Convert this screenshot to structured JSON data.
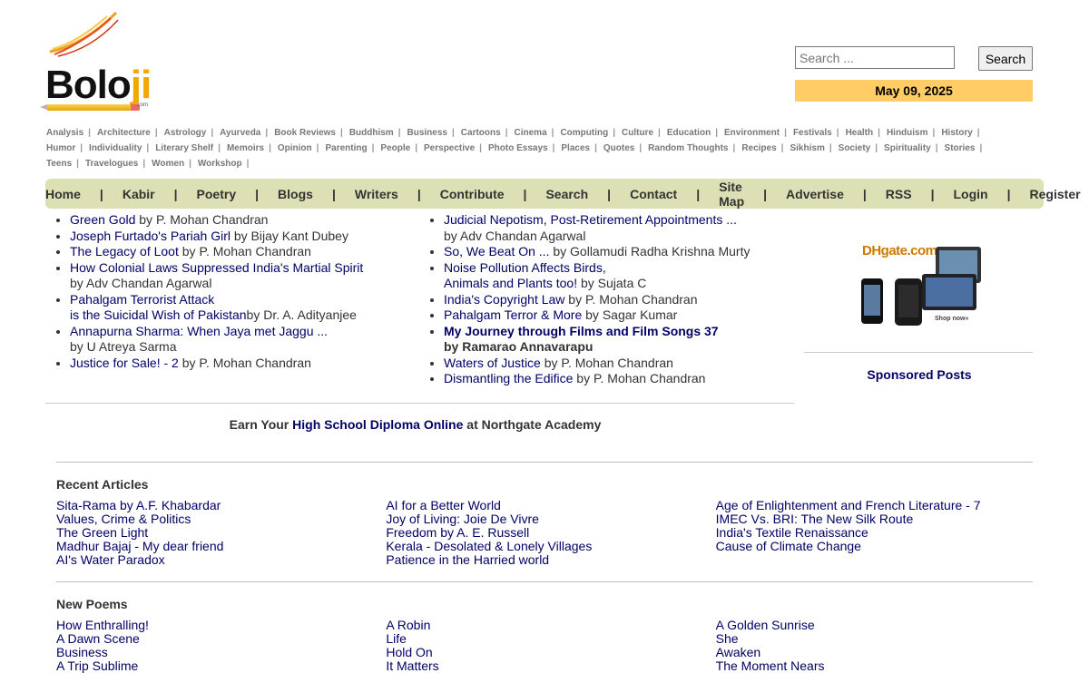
{
  "logo": {
    "text_main": "Bolo",
    "text_accent": "ji",
    "domain_suffix": ".com"
  },
  "search": {
    "placeholder": "Search ...",
    "button_label": "Search"
  },
  "date": "May 09, 2025",
  "categories": [
    "Analysis",
    "Architecture",
    "Astrology",
    "Ayurveda",
    "Book Reviews",
    "Buddhism",
    "Business",
    "Cartoons",
    "Cinema",
    "Computing",
    "Culture",
    "Education",
    "Environment",
    "Festivals",
    "Health",
    "Hinduism",
    "History",
    "Humor",
    "Individuality",
    "Literary Shelf",
    "Memoirs",
    "Opinion",
    "Parenting",
    "People",
    "Perspective",
    "Photo Essays",
    "Places",
    "Quotes",
    "Random Thoughts",
    "Recipes",
    "Sikhism",
    "Society",
    "Spirituality",
    "Stories",
    "Teens",
    "Travelogues",
    "Women",
    "Workshop"
  ],
  "nav": [
    "Home",
    "Kabir",
    "Poetry",
    "Blogs",
    "Writers",
    "Contribute",
    "Search",
    "Contact",
    "Site Map",
    "Advertise",
    "RSS",
    "Login",
    "Register"
  ],
  "featured_left": [
    {
      "title": "Green Gold",
      "by": " by P. Mohan Chandran"
    },
    {
      "title": "Joseph Furtado's Pariah Girl",
      "by": " by Bijay Kant Dubey"
    },
    {
      "title": "The Legacy of Loot",
      "by": " by P. Mohan Chandran"
    },
    {
      "title": "How Colonial Laws Suppressed India's Martial Spirit",
      "by": "by Adv Chandan Agarwal"
    },
    {
      "title": "Pahalgam Terrorist Attack",
      "title2": "is the Suicidal Wish of Pakistan",
      "by": "by Dr. A. Adityanjee"
    },
    {
      "title": "Annapurna Sharma: When Jaya met Jaggu ...",
      "by": "by U Atreya Sarma"
    },
    {
      "title": "Justice for Sale! - 2",
      "by": " by P. Mohan Chandran"
    }
  ],
  "featured_right": [
    {
      "title": "Judicial Nepotism, Post-Retirement Appointments ...",
      "by": "by Adv Chandan Agarwal"
    },
    {
      "title": "So, We Beat On ...",
      "by": " by Gollamudi Radha Krishna Murty"
    },
    {
      "title": "Noise Pollution Affects Birds,",
      "title2": "Animals and Plants too!",
      "by": " by Sujata C"
    },
    {
      "title": "India's Copyright Law",
      "by": " by P. Mohan Chandran"
    },
    {
      "title": "Pahalgam Terror & More",
      "by": " by Sagar Kumar"
    },
    {
      "title": "My Journey through Films and Film Songs 37",
      "by": "by Ramarao Annavarapu"
    },
    {
      "title": "Waters of Justice",
      "by": " by P. Mohan Chandran"
    },
    {
      "title": "Dismantling the Edifice",
      "by": " by P. Mohan Chandran"
    }
  ],
  "ad": {
    "brand": "DHgate.com",
    "cta": "Shop now»"
  },
  "sponsored_label": "Sponsored Posts",
  "promo": {
    "pre": "Earn Your ",
    "link": "High School Diploma Online",
    "post": " at Northgate Academy"
  },
  "recent_articles": {
    "title": "Recent Articles",
    "columns": [
      [
        "Sita-Rama by A.F. Khabardar",
        "Values, Crime & Politics",
        "The Green Light",
        "Madhur Bajaj - My dear friend",
        "AI's Water Paradox"
      ],
      [
        "AI for a Better World",
        "Joy of Living: Joie De Vivre",
        "Freedom by A. E. Russell",
        "Kerala - Desolated & Lonely Villages",
        "Patience in the Harried world"
      ],
      [
        "Age of Enlightenment and French Literature - 7",
        "IMEC Vs. BRI: The New Silk Route",
        "India's Textile Renaissance",
        "Cause of Climate Change"
      ]
    ]
  },
  "new_poems": {
    "title": "New Poems",
    "columns": [
      [
        "How Enthralling!",
        "A Dawn Scene",
        "Business",
        "A Trip Sublime"
      ],
      [
        "A Robin",
        "Life",
        "Hold On",
        "It Matters"
      ],
      [
        "A Golden Sunrise",
        "She",
        "Awaken",
        "The Moment Nears"
      ]
    ]
  },
  "colors": {
    "link": "#000066",
    "nav_bg": "#dde0b4",
    "date_bg": "#ffcc66",
    "logo_accent": "#f2a800"
  }
}
